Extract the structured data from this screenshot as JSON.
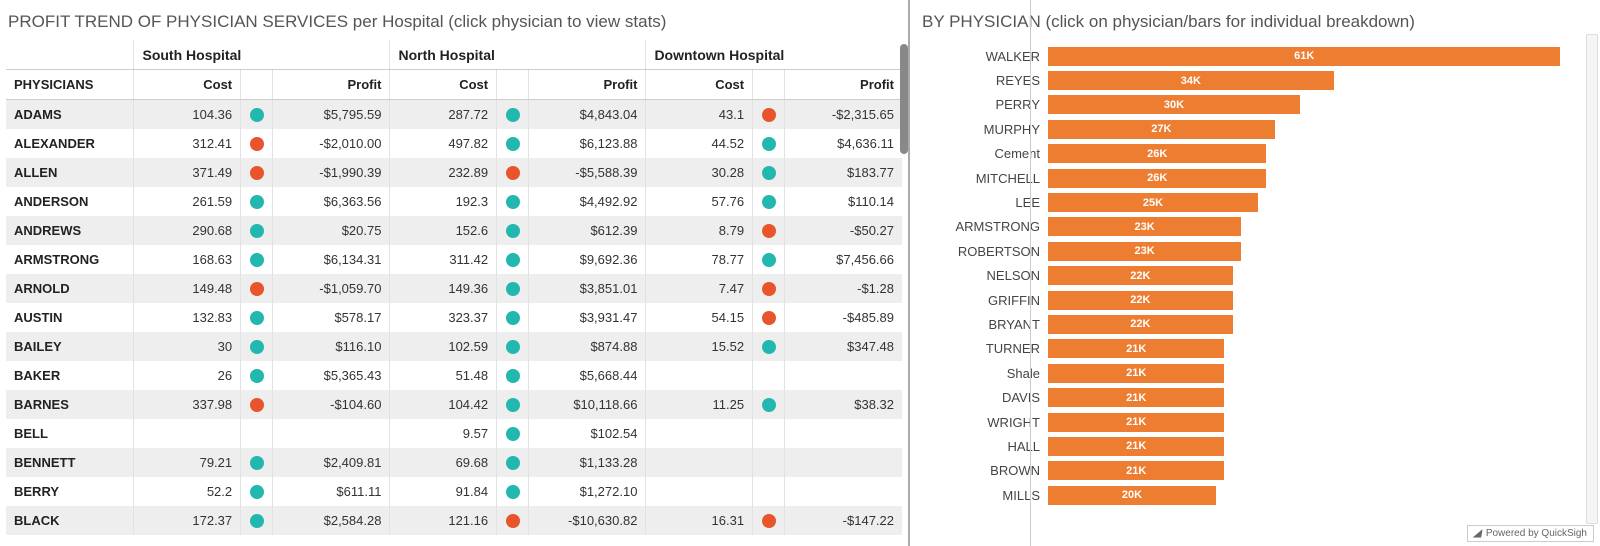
{
  "left_title": "PROFIT TREND OF PHYSICIAN SERVICES per Hospital (click physician to view stats)",
  "right_title": "BY PHYSICIAN (click on physician/bars for individual breakdown)",
  "hospitals": [
    "South Hospital",
    "North Hospital",
    "Downtown Hospital"
  ],
  "col_physicians": "PHYSICIANS",
  "col_cost": "Cost",
  "col_profit": "Profit",
  "rows": [
    {
      "name": "ADAMS",
      "south": {
        "cost": "104.36",
        "sign": "pos",
        "profit": "$5,795.59"
      },
      "north": {
        "cost": "287.72",
        "sign": "pos",
        "profit": "$4,843.04"
      },
      "down": {
        "cost": "43.1",
        "sign": "neg",
        "profit": "-$2,315.65"
      }
    },
    {
      "name": "ALEXANDER",
      "south": {
        "cost": "312.41",
        "sign": "neg",
        "profit": "-$2,010.00"
      },
      "north": {
        "cost": "497.82",
        "sign": "pos",
        "profit": "$6,123.88"
      },
      "down": {
        "cost": "44.52",
        "sign": "pos",
        "profit": "$4,636.11"
      }
    },
    {
      "name": "ALLEN",
      "south": {
        "cost": "371.49",
        "sign": "neg",
        "profit": "-$1,990.39"
      },
      "north": {
        "cost": "232.89",
        "sign": "neg",
        "profit": "-$5,588.39"
      },
      "down": {
        "cost": "30.28",
        "sign": "pos",
        "profit": "$183.77"
      }
    },
    {
      "name": "ANDERSON",
      "south": {
        "cost": "261.59",
        "sign": "pos",
        "profit": "$6,363.56"
      },
      "north": {
        "cost": "192.3",
        "sign": "pos",
        "profit": "$4,492.92"
      },
      "down": {
        "cost": "57.76",
        "sign": "pos",
        "profit": "$110.14"
      }
    },
    {
      "name": "ANDREWS",
      "south": {
        "cost": "290.68",
        "sign": "pos",
        "profit": "$20.75"
      },
      "north": {
        "cost": "152.6",
        "sign": "pos",
        "profit": "$612.39"
      },
      "down": {
        "cost": "8.79",
        "sign": "neg",
        "profit": "-$50.27"
      }
    },
    {
      "name": "ARMSTRONG",
      "south": {
        "cost": "168.63",
        "sign": "pos",
        "profit": "$6,134.31"
      },
      "north": {
        "cost": "311.42",
        "sign": "pos",
        "profit": "$9,692.36"
      },
      "down": {
        "cost": "78.77",
        "sign": "pos",
        "profit": "$7,456.66"
      }
    },
    {
      "name": "ARNOLD",
      "south": {
        "cost": "149.48",
        "sign": "neg",
        "profit": "-$1,059.70"
      },
      "north": {
        "cost": "149.36",
        "sign": "pos",
        "profit": "$3,851.01"
      },
      "down": {
        "cost": "7.47",
        "sign": "neg",
        "profit": "-$1.28"
      }
    },
    {
      "name": "AUSTIN",
      "south": {
        "cost": "132.83",
        "sign": "pos",
        "profit": "$578.17"
      },
      "north": {
        "cost": "323.37",
        "sign": "pos",
        "profit": "$3,931.47"
      },
      "down": {
        "cost": "54.15",
        "sign": "neg",
        "profit": "-$485.89"
      }
    },
    {
      "name": "BAILEY",
      "south": {
        "cost": "30",
        "sign": "pos",
        "profit": "$116.10"
      },
      "north": {
        "cost": "102.59",
        "sign": "pos",
        "profit": "$874.88"
      },
      "down": {
        "cost": "15.52",
        "sign": "pos",
        "profit": "$347.48"
      }
    },
    {
      "name": "BAKER",
      "south": {
        "cost": "26",
        "sign": "pos",
        "profit": "$5,365.43"
      },
      "north": {
        "cost": "51.48",
        "sign": "pos",
        "profit": "$5,668.44"
      },
      "down": {
        "cost": "",
        "sign": "",
        "profit": ""
      }
    },
    {
      "name": "BARNES",
      "south": {
        "cost": "337.98",
        "sign": "neg",
        "profit": "-$104.60"
      },
      "north": {
        "cost": "104.42",
        "sign": "pos",
        "profit": "$10,118.66"
      },
      "down": {
        "cost": "11.25",
        "sign": "pos",
        "profit": "$38.32"
      }
    },
    {
      "name": "BELL",
      "south": {
        "cost": "",
        "sign": "",
        "profit": ""
      },
      "north": {
        "cost": "9.57",
        "sign": "pos",
        "profit": "$102.54"
      },
      "down": {
        "cost": "",
        "sign": "",
        "profit": ""
      }
    },
    {
      "name": "BENNETT",
      "south": {
        "cost": "79.21",
        "sign": "pos",
        "profit": "$2,409.81"
      },
      "north": {
        "cost": "69.68",
        "sign": "pos",
        "profit": "$1,133.28"
      },
      "down": {
        "cost": "",
        "sign": "",
        "profit": ""
      }
    },
    {
      "name": "BERRY",
      "south": {
        "cost": "52.2",
        "sign": "pos",
        "profit": "$611.11"
      },
      "north": {
        "cost": "91.84",
        "sign": "pos",
        "profit": "$1,272.10"
      },
      "down": {
        "cost": "",
        "sign": "",
        "profit": ""
      }
    },
    {
      "name": "BLACK",
      "south": {
        "cost": "172.37",
        "sign": "pos",
        "profit": "$2,584.28"
      },
      "north": {
        "cost": "121.16",
        "sign": "neg",
        "profit": "-$10,630.82"
      },
      "down": {
        "cost": "16.31",
        "sign": "neg",
        "profit": "-$147.22"
      }
    }
  ],
  "chart_data": {
    "type": "bar",
    "orientation": "horizontal",
    "title": "BY PHYSICIAN (click on physician/bars for individual breakdown)",
    "xlabel": "",
    "ylabel": "",
    "xlim": [
      0,
      65
    ],
    "unit": "K",
    "categories": [
      "WALKER",
      "REYES",
      "PERRY",
      "MURPHY",
      "Cement",
      "MITCHELL",
      "LEE",
      "ARMSTRONG",
      "ROBERTSON",
      "NELSON",
      "GRIFFIN",
      "BRYANT",
      "TURNER",
      "Shale",
      "DAVIS",
      "WRIGHT",
      "HALL",
      "BROWN",
      "MILLS"
    ],
    "values": [
      61,
      34,
      30,
      27,
      26,
      26,
      25,
      23,
      23,
      22,
      22,
      22,
      21,
      21,
      21,
      21,
      21,
      21,
      20
    ],
    "color": "#ed7d31"
  },
  "footer_label": "Powered by QuickSigh"
}
